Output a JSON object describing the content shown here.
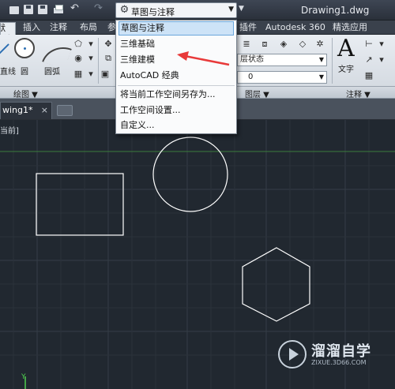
{
  "quick_access": {
    "workspace_current": "草图与注释",
    "title": "Drawing1.dwg",
    "undo_glyph": "↶",
    "redo_glyph": "↷",
    "more_glyph": "▼"
  },
  "ribbon_tabs": [
    "默认",
    "插入",
    "注释",
    "布局",
    "参",
    "插件",
    "Autodesk 360",
    "精选应用"
  ],
  "ribbon": {
    "draw_tools": [
      "直线",
      "圆",
      "圆弧"
    ],
    "layer_dropdown_1": "层状态",
    "layer_dropdown_2": "0",
    "text_tool": "文字",
    "groups": [
      "绘图 ▼",
      "图层 ▼",
      "注释 ▼"
    ]
  },
  "document_tab": {
    "label": "wing1*",
    "close": "×"
  },
  "viewport_label": "当前]",
  "workspace_menu": {
    "items": [
      "草图与注释",
      "三维基础",
      "三维建模",
      "AutoCAD 经典",
      "将当前工作空间另存为...",
      "工作空间设置...",
      "自定义..."
    ],
    "selected_index": 0
  },
  "watermark": {
    "name": "溜溜自学",
    "url": "ZIXUE.3D66.COM"
  },
  "colors": {
    "canvas": "#212830",
    "grid": "#353d47",
    "axis_x": "#3b7d3b",
    "shape": "#ffffff",
    "annotation_arrow": "#e83a3a",
    "menu_highlight": "#cde3f7"
  }
}
